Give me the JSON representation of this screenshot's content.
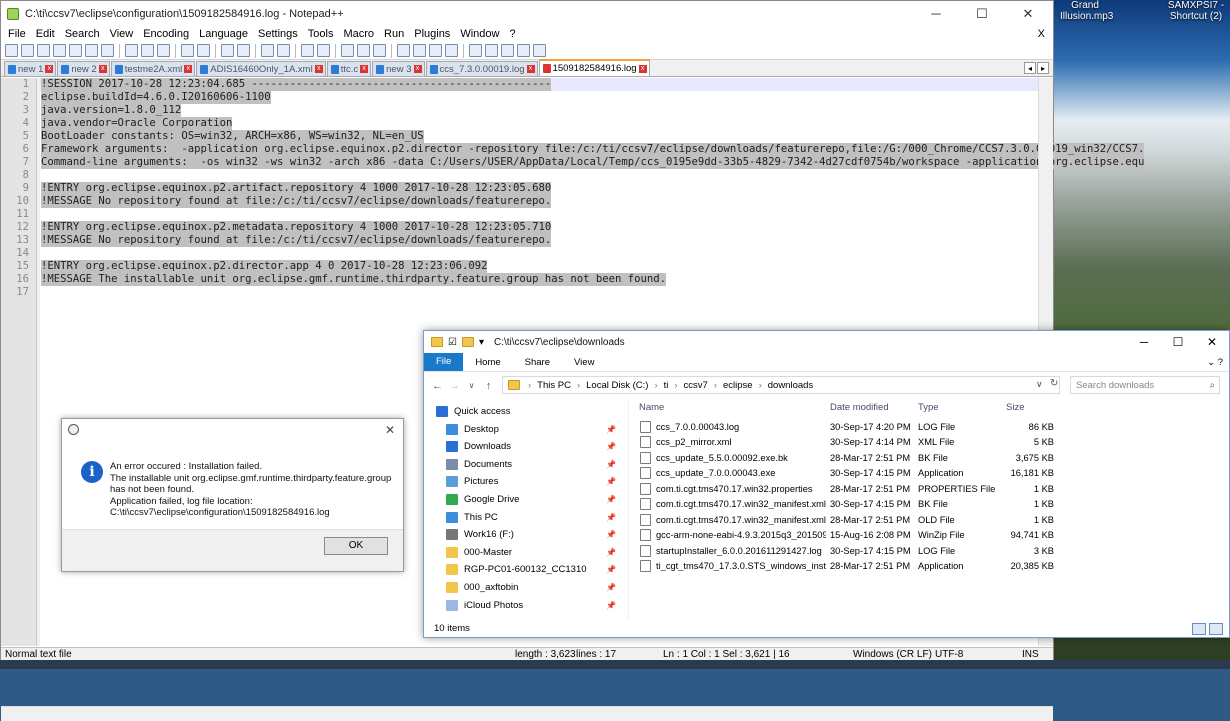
{
  "desktop": {
    "icons": [
      {
        "label": "Grand Illusion.mp3"
      },
      {
        "label": "SAMXPSI7 - Shortcut (2)"
      }
    ]
  },
  "notepad": {
    "title": "C:\\ti\\ccsv7\\eclipse\\configuration\\1509182584916.log - Notepad++",
    "menu": [
      "File",
      "Edit",
      "Search",
      "View",
      "Encoding",
      "Language",
      "Settings",
      "Tools",
      "Macro",
      "Run",
      "Plugins",
      "Window",
      "?"
    ],
    "menu_close": "X",
    "tabs": [
      {
        "label": "new 1",
        "active": false
      },
      {
        "label": "new 2",
        "active": false
      },
      {
        "label": "testme2A.xml",
        "active": false
      },
      {
        "label": "ADIS16460Only_1A.xml",
        "active": false
      },
      {
        "label": "ttc.c",
        "active": false
      },
      {
        "label": "new 3",
        "active": false
      },
      {
        "label": "ccs_7.3.0.00019.log",
        "active": false
      },
      {
        "label": "1509182584916.log",
        "active": true
      }
    ],
    "lines": [
      "!SESSION 2017-10-28 12:23:04.685 -----------------------------------------------",
      "eclipse.buildId=4.6.0.I20160606-1100",
      "java.version=1.8.0_112",
      "java.vendor=Oracle Corporation",
      "BootLoader constants: OS=win32, ARCH=x86, WS=win32, NL=en_US",
      "Framework arguments:  -application org.eclipse.equinox.p2.director -repository file:/c:/ti/ccsv7/eclipse/downloads/featurerepo,file:/G:/000_Chrome/CCS7.3.0.00019_win32/CCS7.",
      "Command-line arguments:  -os win32 -ws win32 -arch x86 -data C:/Users/USER/AppData/Local/Temp/ccs_0195e9dd-33b5-4829-7342-4d27cdf0754b/workspace -application org.eclipse.equ",
      "",
      "!ENTRY org.eclipse.equinox.p2.artifact.repository 4 1000 2017-10-28 12:23:05.680",
      "!MESSAGE No repository found at file:/c:/ti/ccsv7/eclipse/downloads/featurerepo.",
      "",
      "!ENTRY org.eclipse.equinox.p2.metadata.repository 4 1000 2017-10-28 12:23:05.710",
      "!MESSAGE No repository found at file:/c:/ti/ccsv7/eclipse/downloads/featurerepo.",
      "",
      "!ENTRY org.eclipse.equinox.p2.director.app 4 0 2017-10-28 12:23:06.092",
      "!MESSAGE The installable unit org.eclipse.gmf.runtime.thirdparty.feature.group has not been found."
    ],
    "status": {
      "type": "Normal text file",
      "length": "length : 3,623",
      "lines": "lines : 17",
      "pos": "Ln : 1    Col : 1    Sel : 3,621 | 16",
      "eol": "Windows (CR LF)",
      "encoding": "UTF-8",
      "mode": "INS"
    }
  },
  "dialog": {
    "close": "✕",
    "message": [
      "An error occured : Installation failed.",
      "The installable unit org.eclipse.gmf.runtime.thirdparty.feature.group has not been found.",
      "Application failed, log file location:",
      "C:\\ti\\ccsv7\\eclipse\\configuration\\1509182584916.log"
    ],
    "ok": "OK"
  },
  "explorer": {
    "title_path": "C:\\ti\\ccsv7\\eclipse\\downloads",
    "ribbon": [
      "File",
      "Home",
      "Share",
      "View"
    ],
    "breadcrumb": [
      "This PC",
      "Local Disk (C:)",
      "ti",
      "ccsv7",
      "eclipse",
      "downloads"
    ],
    "search_placeholder": "Search downloads",
    "nav": [
      {
        "label": "Quick access",
        "color": "#2b6fd6",
        "pinned": false
      },
      {
        "label": "Desktop",
        "color": "#3b8de0",
        "pinned": true
      },
      {
        "label": "Downloads",
        "color": "#2b6fd6",
        "pinned": true
      },
      {
        "label": "Documents",
        "color": "#7a8ca8",
        "pinned": true
      },
      {
        "label": "Pictures",
        "color": "#5aa0d8",
        "pinned": true
      },
      {
        "label": "Google Drive",
        "color": "#34a853",
        "pinned": true
      },
      {
        "label": "This PC",
        "color": "#3b8de0",
        "pinned": true
      },
      {
        "label": "Work16 (F:)",
        "color": "#777777",
        "pinned": true
      },
      {
        "label": "000-Master",
        "color": "#f3c64b",
        "pinned": true
      },
      {
        "label": "RGP-PC01-600132_CC1310",
        "color": "#f3c64b",
        "pinned": true
      },
      {
        "label": "000_axftobin",
        "color": "#f3c64b",
        "pinned": true
      },
      {
        "label": "iCloud Photos",
        "color": "#9ab8e6",
        "pinned": true
      }
    ],
    "columns": [
      "Name",
      "Date modified",
      "Type",
      "Size"
    ],
    "files": [
      {
        "name": "ccs_7.0.0.00043.log",
        "date": "30-Sep-17 4:20 PM",
        "type": "LOG File",
        "size": "86 KB"
      },
      {
        "name": "ccs_p2_mirror.xml",
        "date": "30-Sep-17 4:14 PM",
        "type": "XML File",
        "size": "5 KB"
      },
      {
        "name": "ccs_update_5.5.0.00092.exe.bk",
        "date": "28-Mar-17 2:51 PM",
        "type": "BK File",
        "size": "3,675 KB"
      },
      {
        "name": "ccs_update_7.0.0.00043.exe",
        "date": "30-Sep-17 4:15 PM",
        "type": "Application",
        "size": "16,181 KB"
      },
      {
        "name": "com.ti.cgt.tms470.17.win32.properties",
        "date": "28-Mar-17 2:51 PM",
        "type": "PROPERTIES File",
        "size": "1 KB"
      },
      {
        "name": "com.ti.cgt.tms470.17.win32_manifest.xml...",
        "date": "30-Sep-17 4:15 PM",
        "type": "BK File",
        "size": "1 KB"
      },
      {
        "name": "com.ti.cgt.tms470.17.win32_manifest.xml...",
        "date": "28-Mar-17 2:51 PM",
        "type": "OLD File",
        "size": "1 KB"
      },
      {
        "name": "gcc-arm-none-eabi-4.9.3.2015q3_201509...",
        "date": "15-Aug-16 2:08 PM",
        "type": "WinZip File",
        "size": "94,741 KB"
      },
      {
        "name": "startupInstaller_6.0.0.201611291427.log",
        "date": "30-Sep-17 4:15 PM",
        "type": "LOG File",
        "size": "3 KB"
      },
      {
        "name": "ti_cgt_tms470_17.3.0.STS_windows_install...",
        "date": "28-Mar-17 2:51 PM",
        "type": "Application",
        "size": "20,385 KB"
      }
    ],
    "status": "10 items"
  }
}
